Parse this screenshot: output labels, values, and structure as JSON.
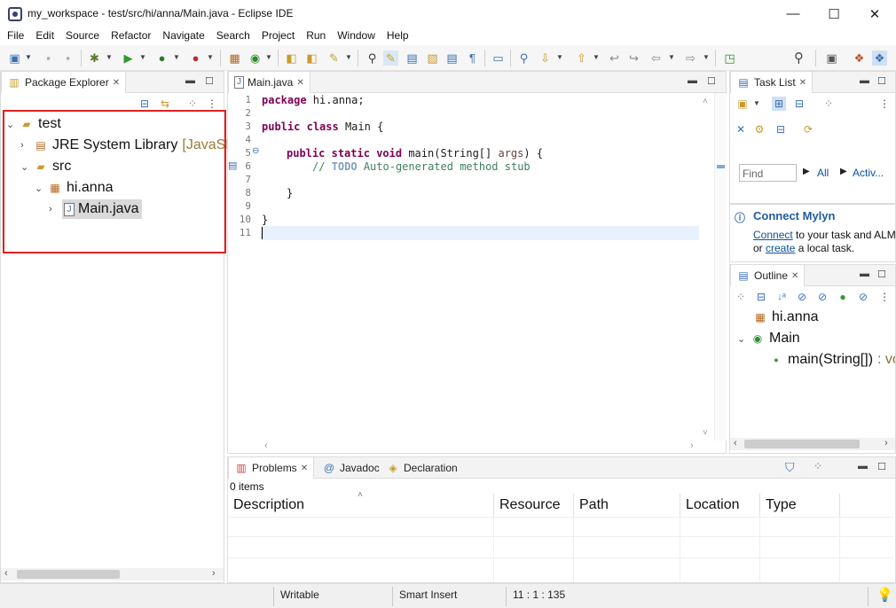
{
  "window": {
    "title": "my_workspace - test/src/hi/anna/Main.java - Eclipse IDE",
    "minimize_glyph": "—",
    "maximize_glyph": "☐",
    "close_glyph": "✕"
  },
  "menubar": [
    "File",
    "Edit",
    "Source",
    "Refactor",
    "Navigate",
    "Search",
    "Project",
    "Run",
    "Window",
    "Help"
  ],
  "package_explorer": {
    "tab_label": "Package Explorer",
    "tree": {
      "project": "test",
      "jre": "JRE System Library",
      "jre_suffix": "[JavaSE",
      "src": "src",
      "package": "hi.anna",
      "file": "Main.java"
    },
    "selected_item": "Main.java"
  },
  "editor": {
    "tab_label": "Main.java",
    "line_numbers": [
      "1",
      "2",
      "3",
      "4",
      "5",
      "6",
      "7",
      "8",
      "9",
      "10",
      "11"
    ],
    "lines": {
      "l1_kw": "package",
      "l1_rest": " hi.anna;",
      "l3_kw1": "public",
      "l3_kw2": "class",
      "l3_rest": " Main {",
      "l5_kw1": "public",
      "l5_kw2": "static",
      "l5_kw3": "void",
      "l5_rest1": " main(String[] ",
      "l5_param": "args",
      "l5_rest2": ") {",
      "l6_comment": "// ",
      "l6_todo": "TODO",
      "l6_rest": " Auto-generated method stub",
      "l8": "}",
      "l10": "}"
    },
    "cursor": "11 : 1 : 135"
  },
  "task_list": {
    "tab_label": "Task List",
    "find_placeholder": "Find",
    "all_label": "All",
    "activate_label": "Activ..."
  },
  "mylyn": {
    "title": "Connect Mylyn",
    "line1_link": "Connect",
    "line1_rest": " to your task and ALM tools",
    "line2_prefix": "or ",
    "line2_link": "create",
    "line2_rest": " a local task."
  },
  "outline": {
    "tab_label": "Outline",
    "items": {
      "package": "hi.anna",
      "class": "Main",
      "method": "main(String[])",
      "method_suffix": " : void"
    }
  },
  "bottom_panel": {
    "tabs": [
      "Problems",
      "Javadoc",
      "Declaration"
    ],
    "count": "0 items",
    "columns": [
      "Description",
      "Resource",
      "Path",
      "Location",
      "Type"
    ]
  },
  "status": {
    "writable": "Writable",
    "insert_mode": "Smart Insert",
    "position": "11 : 1 : 135"
  },
  "colors": {
    "keyword": "#7f0055",
    "comment": "#3f7f5f",
    "link": "#0b4f9e",
    "highlight_box": "#e02020",
    "current_line": "#e8f2fe"
  }
}
